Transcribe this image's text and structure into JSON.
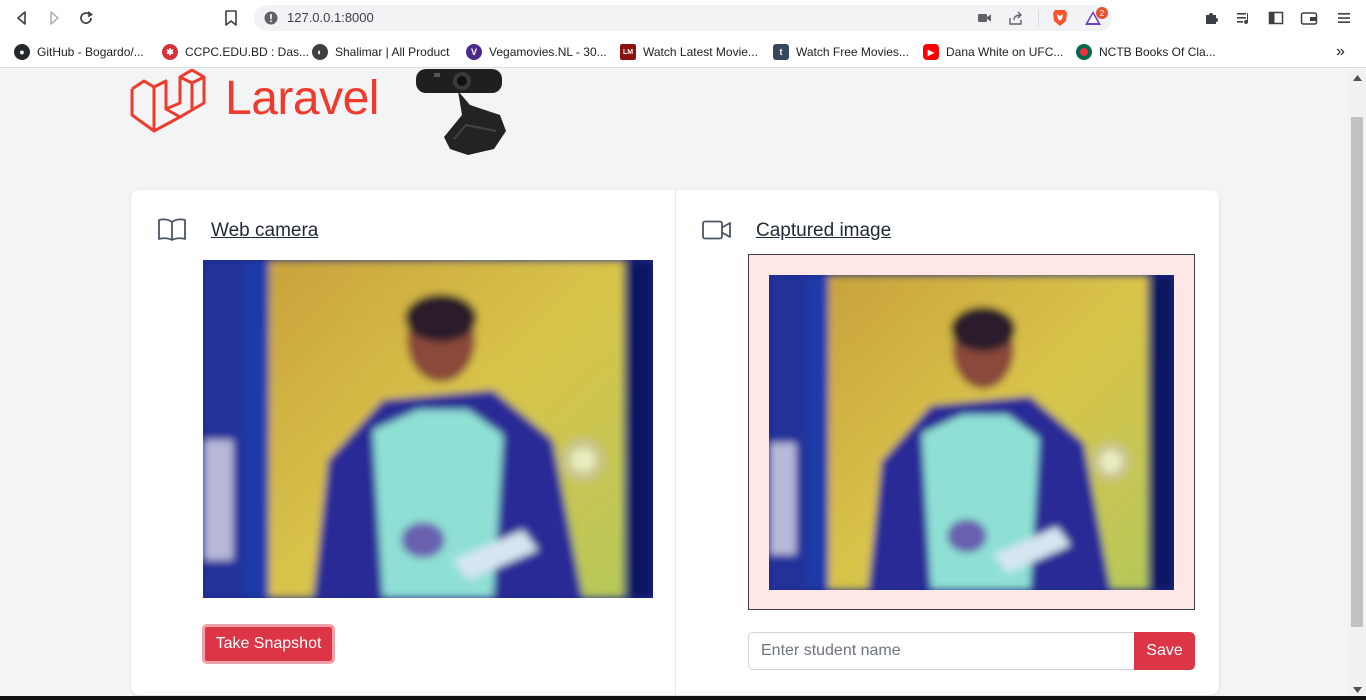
{
  "browser": {
    "url": "127.0.0.1:8000",
    "bookmarks": [
      {
        "label": "GitHub - Bogardo/...",
        "icon": "github-icon",
        "color": "#24292e"
      },
      {
        "label": "CCPC.EDU.BD : Das...",
        "icon": "ccpc-icon",
        "color": "#d6313a"
      },
      {
        "label": "Shalimar | All Product",
        "icon": "globe-icon",
        "color": "#3c4043"
      },
      {
        "label": "Vegamovies.NL - 30...",
        "icon": "vegamovies-icon",
        "color": "#4b2a8a"
      },
      {
        "label": "Watch Latest Movie...",
        "icon": "lm-icon",
        "color": "#8b1010"
      },
      {
        "label": "Watch Free Movies...",
        "icon": "tumblr-icon",
        "color": "#36465d"
      },
      {
        "label": "Dana White on UFC...",
        "icon": "youtube-icon",
        "color": "#ff0000"
      },
      {
        "label": "NCTB Books Of Cla...",
        "icon": "bd-flag-icon",
        "color": "#006a4e"
      }
    ],
    "brave_badge": "2"
  },
  "page": {
    "logo_text": "Laravel",
    "left_panel": {
      "title": "Web camera",
      "icon": "book-open-icon",
      "snapshot_button": "Take Snapshot"
    },
    "right_panel": {
      "title": "Captured image",
      "icon": "video-camera-icon",
      "input_placeholder": "Enter student name",
      "save_button": "Save"
    }
  },
  "colors": {
    "brand_red": "#ef3b2d",
    "button_red": "#dc3545",
    "capture_bg": "#fee7e7"
  }
}
